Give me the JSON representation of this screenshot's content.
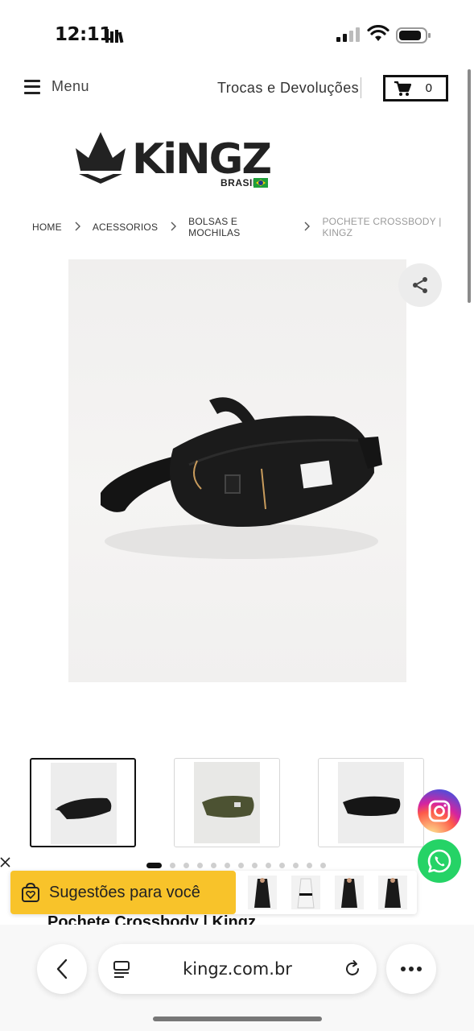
{
  "status_bar": {
    "time": "12:11"
  },
  "header": {
    "menu_label": "Menu",
    "trocas_label": "Trocas e Devoluções",
    "cart_count": "0"
  },
  "logo": {
    "wordmark": "KiNGZ",
    "subtitle": "BRASIL"
  },
  "breadcrumb": [
    {
      "label": "HOME"
    },
    {
      "label": "ACESSORIOS"
    },
    {
      "label": "BOLSAS E MOCHILAS"
    },
    {
      "label": "POCHETE CROSSBODY | KINGZ"
    }
  ],
  "product": {
    "title": "Pochete Crossbody | Kingz",
    "thumbnail_colors": [
      "black",
      "olive-green",
      "black"
    ]
  },
  "carousel": {
    "dot_count": 13,
    "active_index": 0
  },
  "suggestions": {
    "label": "Sugestões para você"
  },
  "browser": {
    "url": "kingz.com.br"
  },
  "colors": {
    "accent_yellow": "#f8c32a",
    "whatsapp_green": "#25d366",
    "brand_black": "#111111"
  },
  "icons": [
    "hamburger-icon",
    "cart-icon",
    "share-icon",
    "instagram-icon",
    "whatsapp-icon",
    "heart-bag-icon",
    "close-icon",
    "back-arrow-icon",
    "tabs-icon",
    "reload-icon",
    "more-icon"
  ]
}
